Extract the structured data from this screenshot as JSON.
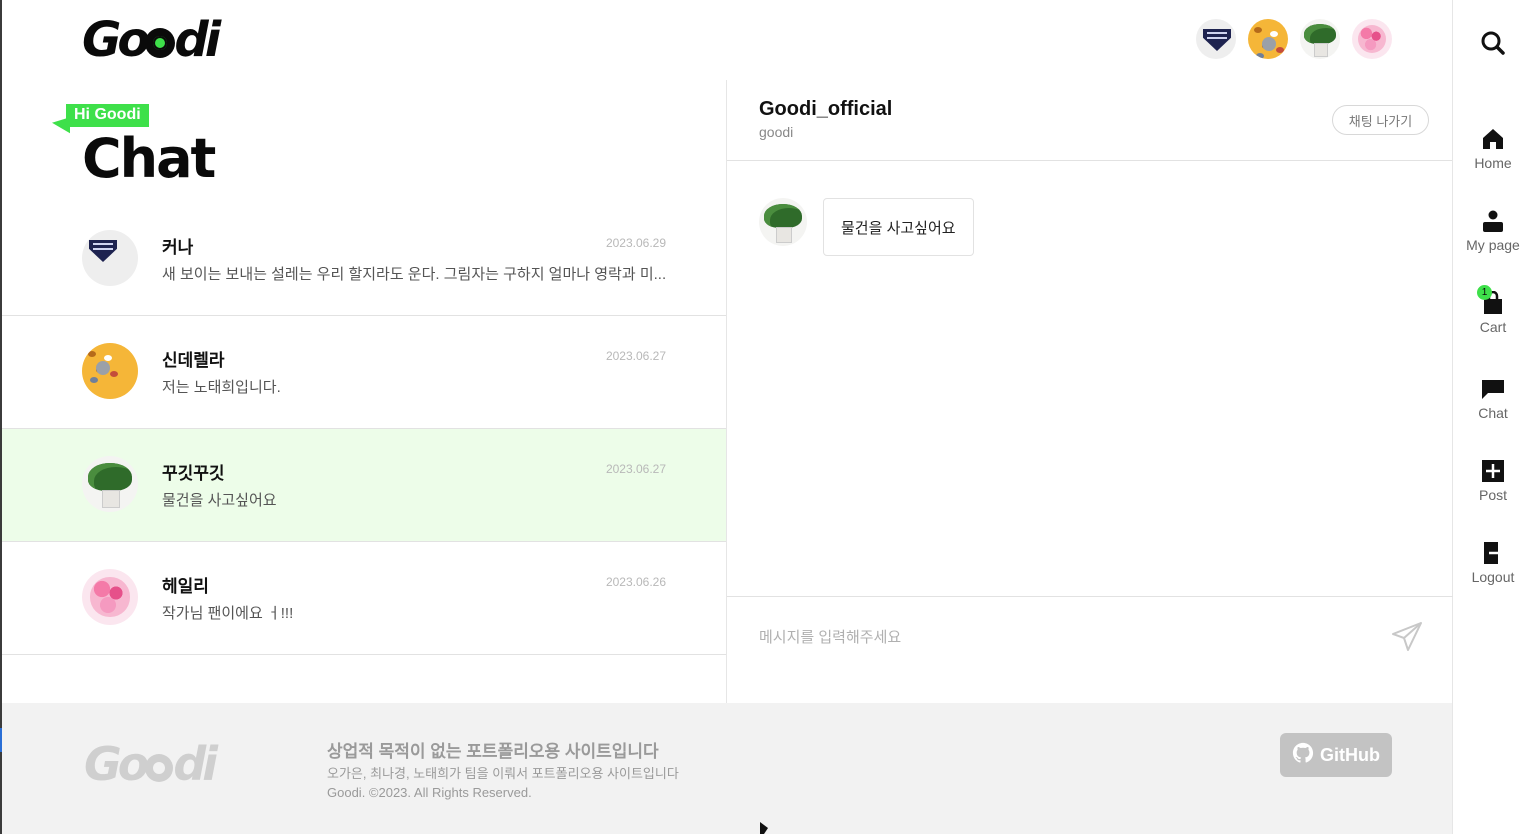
{
  "brand": {
    "logo_text_pre": "Go",
    "logo_text_post": "di",
    "accent_color": "#3ee04a"
  },
  "header": {
    "avatars": [
      {
        "name": "커나",
        "art": "scarf"
      },
      {
        "name": "신데렐라",
        "art": "yellow"
      },
      {
        "name": "꾸깃꾸깃",
        "art": "plant"
      },
      {
        "name": "헤일리",
        "art": "pink"
      }
    ]
  },
  "nav": {
    "search_icon": "search-icon",
    "items": [
      {
        "label": "Home",
        "icon": "home-icon"
      },
      {
        "label": "My page",
        "icon": "user-icon"
      },
      {
        "label": "Cart",
        "icon": "bag-icon",
        "badge": "1"
      },
      {
        "label": "Chat",
        "icon": "chat-icon"
      },
      {
        "label": "Post",
        "icon": "plus-square-icon"
      },
      {
        "label": "Logout",
        "icon": "logout-icon"
      }
    ]
  },
  "list": {
    "tag": "Hi Goodi",
    "title": "Chat",
    "chats": [
      {
        "name": "커나",
        "date": "2023.06.29",
        "preview": "새 보이는 보내는 설레는 우리 할지라도 운다. 그림자는 구하지 얼마나 영락과 미...",
        "art": "scarf",
        "active": false
      },
      {
        "name": "신데렐라",
        "date": "2023.06.27",
        "preview": "저는 노태희입니다.",
        "art": "yellow",
        "active": false
      },
      {
        "name": "꾸깃꾸깃",
        "date": "2023.06.27",
        "preview": "물건을 사고싶어요",
        "art": "plant",
        "active": true
      },
      {
        "name": "헤일리",
        "date": "2023.06.26",
        "preview": "작가님 팬이에요 ㅓ!!!",
        "art": "pink",
        "active": false
      }
    ]
  },
  "conversation": {
    "name": "Goodi_official",
    "sub": "goodi",
    "leave_label": "채팅 나가기",
    "messages": [
      {
        "text": "물건을 사고싶어요",
        "art": "plant"
      }
    ],
    "input_placeholder": "메시지를 입력해주세요",
    "send_icon": "send-icon"
  },
  "footer": {
    "logo_text_pre": "Go",
    "logo_text_post": "di",
    "headline": "상업적 목적이 없는 포트폴리오용 사이트입니다",
    "line1": "오가은, 최나경, 노태희가 팀을 이뤄서 포트폴리오용 사이트입니다",
    "line2": "Goodi. ©2023. All Rights Reserved.",
    "github_label": "GitHub"
  }
}
